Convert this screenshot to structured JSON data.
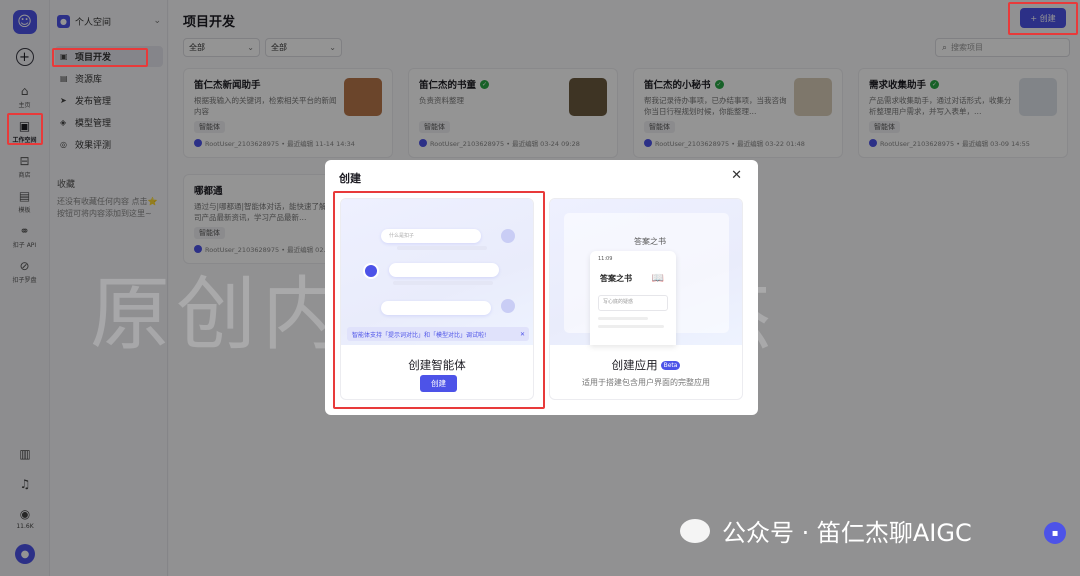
{
  "rail": {
    "items": [
      {
        "label": "主页",
        "icon": "home-icon"
      },
      {
        "label": "工作空间",
        "icon": "workspace-icon"
      },
      {
        "label": "商店",
        "icon": "store-icon"
      },
      {
        "label": "模板",
        "icon": "template-icon"
      },
      {
        "label": "扣子 API",
        "icon": "api-icon"
      },
      {
        "label": "扣子罗盘",
        "icon": "compass-icon"
      }
    ],
    "count": "11.6K"
  },
  "sidebar": {
    "space": "个人空间",
    "nav": [
      {
        "label": "项目开发",
        "icon": "project-icon"
      },
      {
        "label": "资源库",
        "icon": "library-icon"
      },
      {
        "label": "发布管理",
        "icon": "publish-icon"
      },
      {
        "label": "模型管理",
        "icon": "model-icon"
      },
      {
        "label": "效果评测",
        "icon": "evaluate-icon"
      }
    ],
    "fav_title": "收藏",
    "fav_text": "还没有收藏任何内容 点击⭐按钮可将内容添加到这里~"
  },
  "main": {
    "title": "项目开发",
    "create_label": "+ 创建",
    "filters": [
      "全部",
      "全部"
    ],
    "search_placeholder": "搜索项目",
    "cards": [
      {
        "title": "笛仁杰新闻助手",
        "desc": "根据我输入的关键词，检索相关平台的新闻内容",
        "tag": "智能体",
        "foot": "RootUser_2103628975 • 最近编辑 11-14 14:34",
        "verified": false
      },
      {
        "title": "笛仁杰的书童",
        "desc": "负责资料整理",
        "tag": "智能体",
        "foot": "RootUser_2103628975 • 最近编辑 03-24 09:28",
        "verified": true
      },
      {
        "title": "笛仁杰的小秘书",
        "desc": "帮我记录待办事项，已办结事项，当我咨询你当日行程规划时候，你能整理…",
        "tag": "智能体",
        "foot": "RootUser_2103628975 • 最近编辑 03-22 01:48",
        "verified": true
      },
      {
        "title": "需求收集助手",
        "desc": "产品需求收集助手，通过对话形式，收集分析整理用户需求，并写入表单，…",
        "tag": "智能体",
        "foot": "RootUser_2103628975 • 最近编辑 03-09 14:55",
        "verified": true
      },
      {
        "title": "哪都通",
        "desc": "通过与|哪都通|智能体对话，能快速了解公司产品最新资讯，学习产品最新…",
        "tag": "智能体",
        "foot": "RootUser_2103628975 • 最近编辑 02…",
        "verified": false
      }
    ]
  },
  "modal": {
    "title": "创建",
    "close": "✕",
    "agent": {
      "name": "创建智能体",
      "button": "创建",
      "bubble_hint": "什么是扣子",
      "notice": "智能体支持「提示词对比」和「模型对比」调试啦!",
      "notice_close": "✕"
    },
    "app": {
      "name": "创建应用",
      "beta": "Beta",
      "sub": "适用于搭建包含用户界面的完整应用",
      "win_title": "答案之书",
      "phone_time": "11:09",
      "phone_title": "答案之书",
      "phone_box": "写心底的疑惑"
    }
  },
  "watermark": "原创内容@笛仁杰",
  "wechat_label": "公众号 · 笛仁杰聊AIGC",
  "colors": {
    "accent": "#4d53e8",
    "highlight": "#e83a3a",
    "verified": "#28a745"
  }
}
